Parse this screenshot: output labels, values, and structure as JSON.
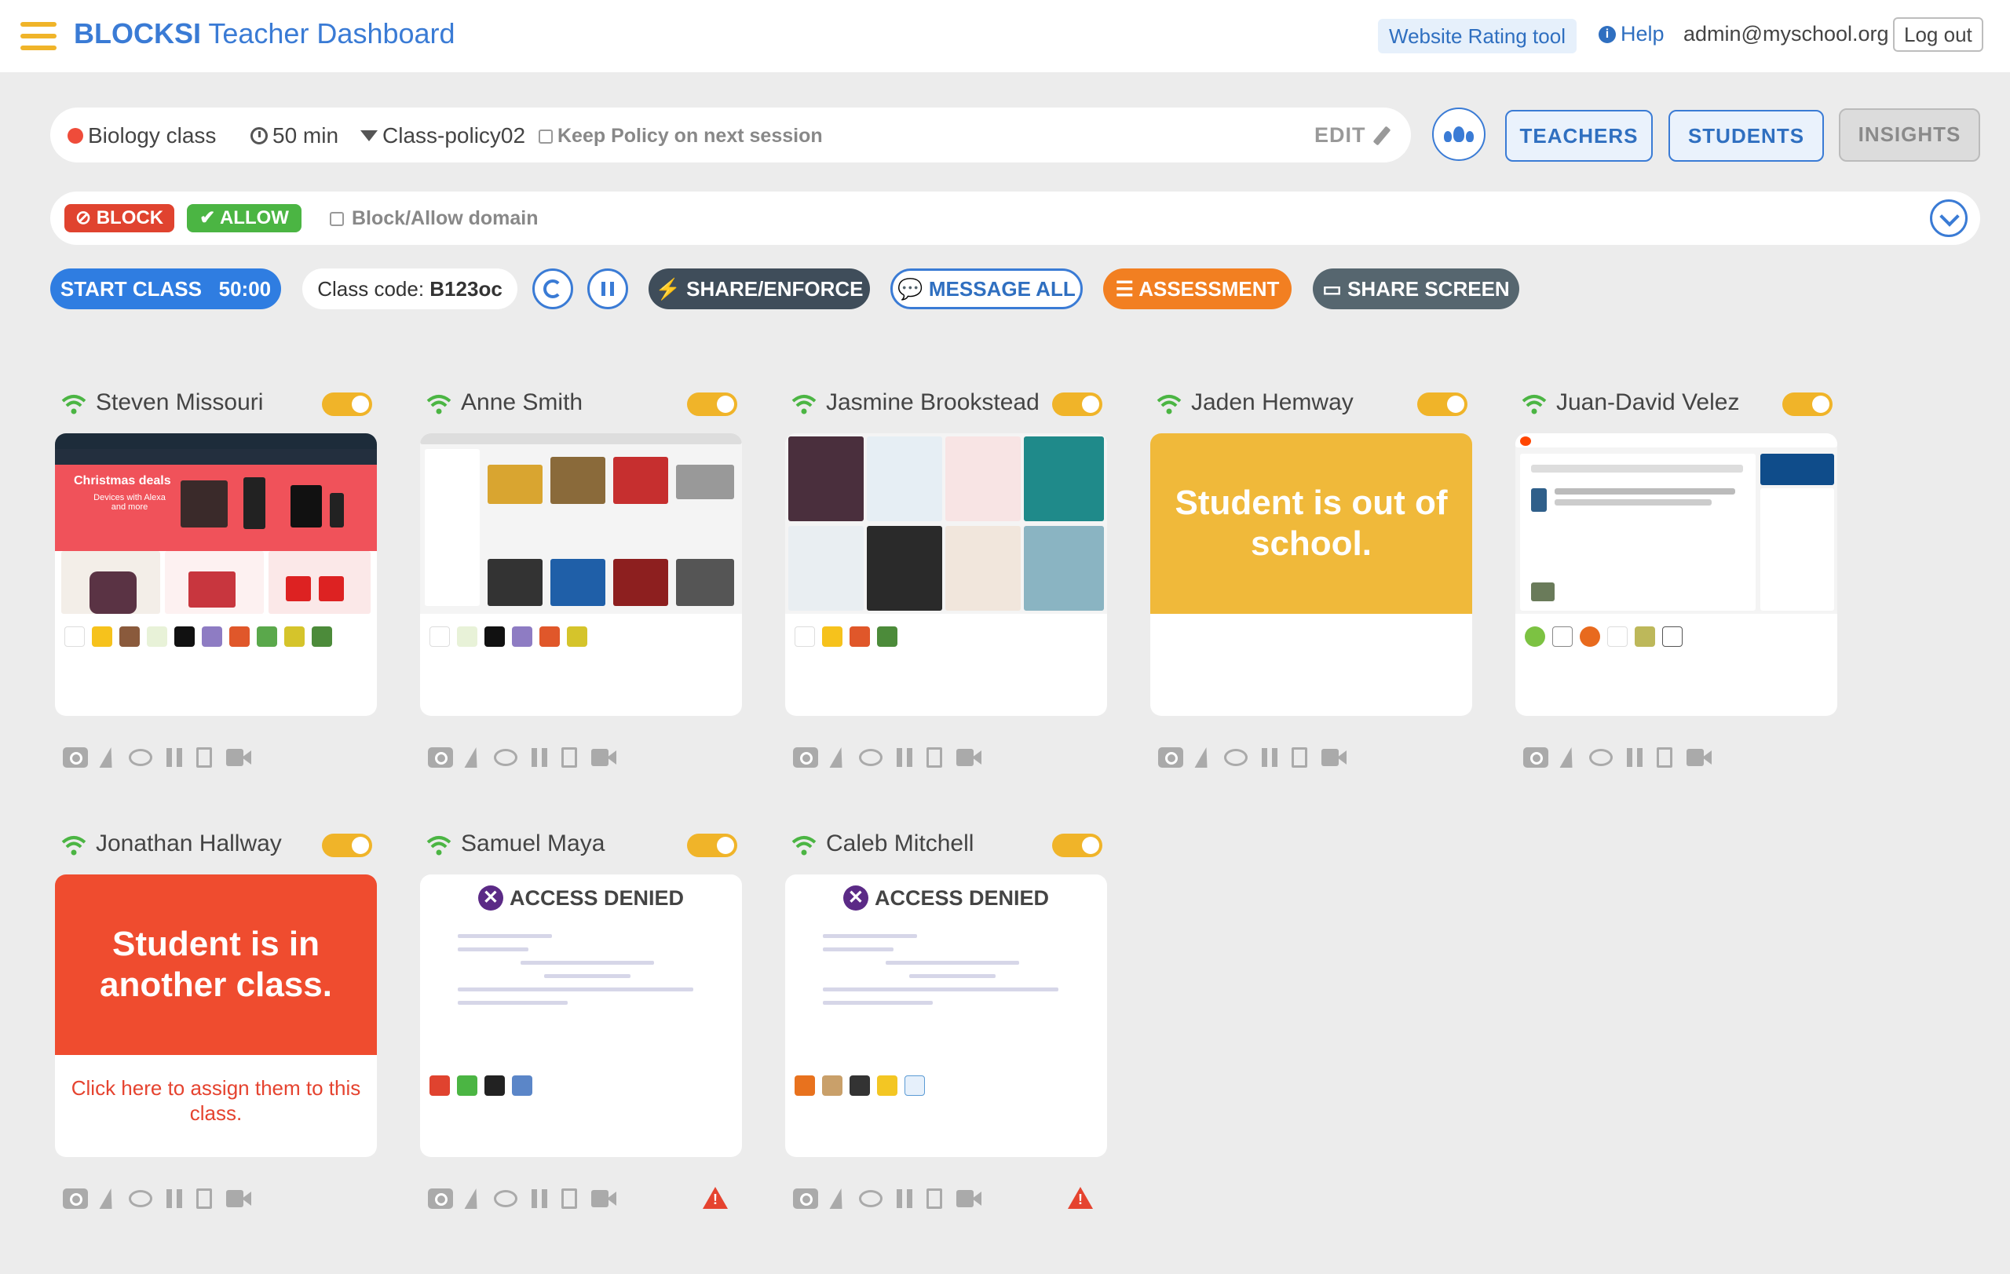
{
  "header": {
    "brand_bold": "BLOCKSI",
    "brand_rest": " Teacher Dashboard",
    "rating_tool": "Website Rating tool",
    "help": "Help",
    "user": "admin@myschool.org",
    "logout": "Log out"
  },
  "classbar": {
    "class_name": "Biology class",
    "duration": "50 min",
    "policy": "Class-policy02",
    "keep_policy": "Keep Policy on next session",
    "edit": "EDIT"
  },
  "tabs": {
    "teachers": "TEACHERS",
    "students": "STUDENTS",
    "insights": "INSIGHTS"
  },
  "domainbar": {
    "block": "BLOCK",
    "allow": "ALLOW",
    "label": "Block/Allow domain"
  },
  "actions": {
    "start": "START CLASS",
    "timer": "50:00",
    "code_label": "Class code: ",
    "code_value": "B123oc",
    "share": "SHARE/ENFORCE",
    "message": "MESSAGE ALL",
    "assessment": "ASSESSMENT",
    "share_screen": "SHARE SCREEN"
  },
  "students": [
    {
      "name": "Steven Missouri",
      "preview": "amazon-christmas-deals",
      "thumb_text": "Christmas deals",
      "thumb_sub": "Devices with Alexa and more"
    },
    {
      "name": "Anne Smith",
      "preview": "shopping-grid"
    },
    {
      "name": "Jasmine Brookstead",
      "preview": "amazon-grid"
    },
    {
      "name": "Jaden Hemway",
      "status": "Student is out of school."
    },
    {
      "name": "Juan-David Velez",
      "preview": "reddit"
    },
    {
      "name": "Jonathan Hallway",
      "status": "Student is in another class.",
      "assign": "Click here to assign them to this class."
    },
    {
      "name": "Samuel Maya",
      "denied": "ACCESS DENIED"
    },
    {
      "name": "Caleb Mitchell",
      "denied": "ACCESS DENIED"
    }
  ],
  "colors": {
    "accent": "#3a7bd5",
    "brand_yellow": "#f0b429",
    "block_red": "#e0432f",
    "allow_green": "#4bb543",
    "assessment_orange": "#f27f21",
    "out_of_school": "#f0b93a",
    "another_class": "#ef4c2f"
  }
}
